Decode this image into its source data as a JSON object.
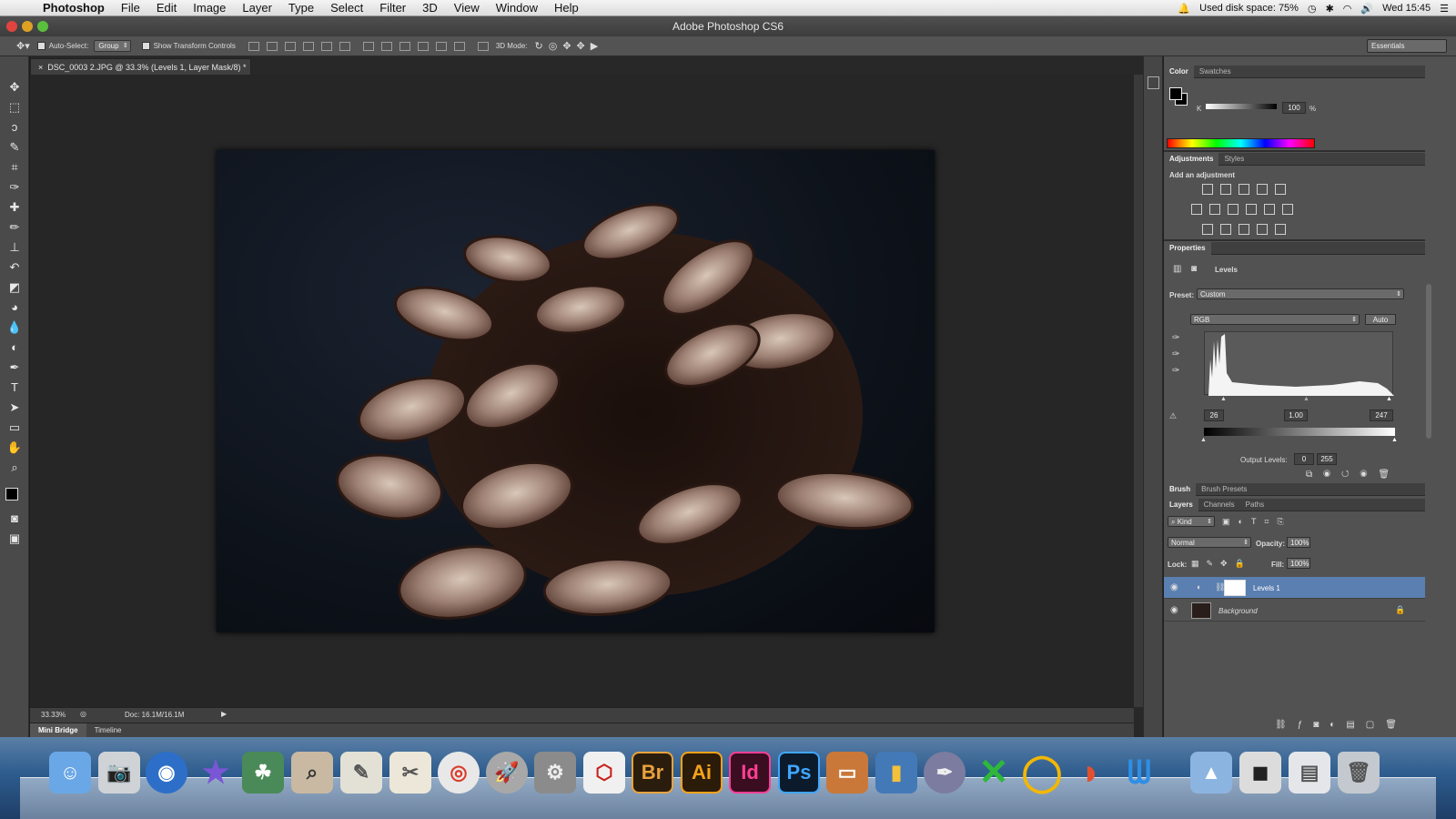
{
  "menubar": {
    "app": "Photoshop",
    "menus": [
      "File",
      "Edit",
      "Image",
      "Layer",
      "Type",
      "Select",
      "Filter",
      "3D",
      "View",
      "Window",
      "Help"
    ],
    "disk": "Used disk space: 75%",
    "clock": "Wed 15:45"
  },
  "window": {
    "title": "Adobe Photoshop CS6"
  },
  "options": {
    "auto_select": "Auto-Select:",
    "group": "Group",
    "transform": "Show Transform Controls",
    "mode3d": "3D Mode:",
    "workspace": "Essentials"
  },
  "document": {
    "tab": "DSC_0003 2.JPG @ 33.3% (Levels 1, Layer Mask/8) *",
    "zoom": "33.33%",
    "doc_size": "Doc: 16.1M/16.1M",
    "bottom_tabs": [
      "Mini Bridge",
      "Timeline"
    ]
  },
  "color_panel": {
    "tabs": [
      "Color",
      "Swatches"
    ],
    "channel": "K",
    "value": "100",
    "unit": "%"
  },
  "adjustments": {
    "tabs": [
      "Adjustments",
      "Styles"
    ],
    "heading": "Add an adjustment"
  },
  "properties": {
    "tab": "Properties",
    "type": "Levels",
    "preset_label": "Preset:",
    "preset": "Custom",
    "channel": "RGB",
    "auto": "Auto",
    "input_black": "26",
    "input_gamma": "1.00",
    "input_white": "247",
    "output_label": "Output Levels:",
    "output_black": "0",
    "output_white": "255"
  },
  "brush_tabs": [
    "Brush",
    "Brush Presets"
  ],
  "layers": {
    "tabs": [
      "Layers",
      "Channels",
      "Paths"
    ],
    "filter": "Kind",
    "blend": "Normal",
    "opacity_label": "Opacity:",
    "opacity": "100%",
    "lock_label": "Lock:",
    "fill_label": "Fill:",
    "fill": "100%",
    "items": [
      {
        "name": "Levels 1",
        "selected": true
      },
      {
        "name": "Background",
        "selected": false
      }
    ]
  },
  "dock": {
    "labels": [
      "Br",
      "Ai",
      "Id",
      "Ps"
    ]
  },
  "colors": {
    "accent": "#5a7fb0",
    "panel": "#525252",
    "canvas": "#282828"
  }
}
